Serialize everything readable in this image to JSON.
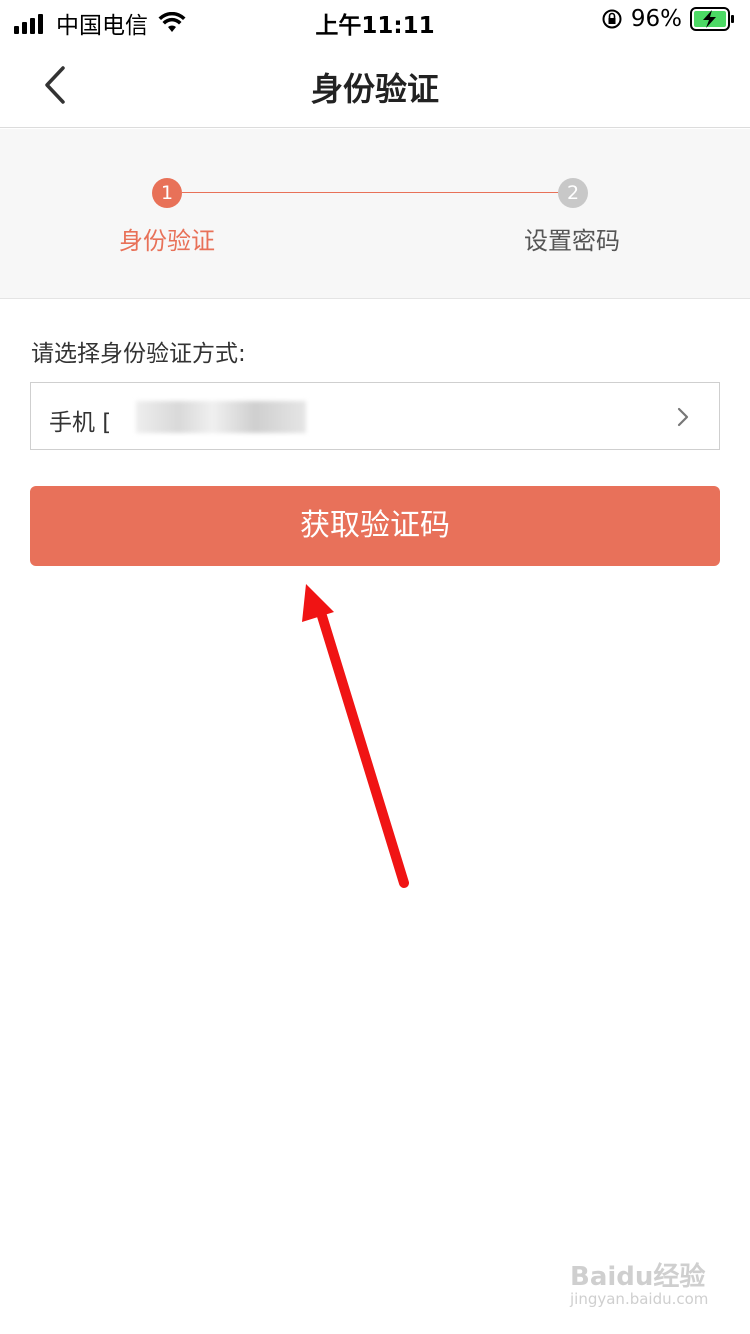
{
  "status_bar": {
    "carrier": "中国电信",
    "time": "上午11:11",
    "battery": "96%"
  },
  "nav": {
    "title": "身份验证"
  },
  "steps": [
    {
      "number": "1",
      "label": "身份验证"
    },
    {
      "number": "2",
      "label": "设置密码"
    }
  ],
  "form": {
    "prompt": "请选择身份验证方式:",
    "method_prefix": "手机 [",
    "button_label": "获取验证码"
  },
  "watermark": {
    "text": "Baidu经验",
    "sub": "jingyan.baidu.com"
  },
  "colors": {
    "accent": "#e8715a",
    "inactive": "#c8c8c8",
    "annotation": "#f01414"
  }
}
